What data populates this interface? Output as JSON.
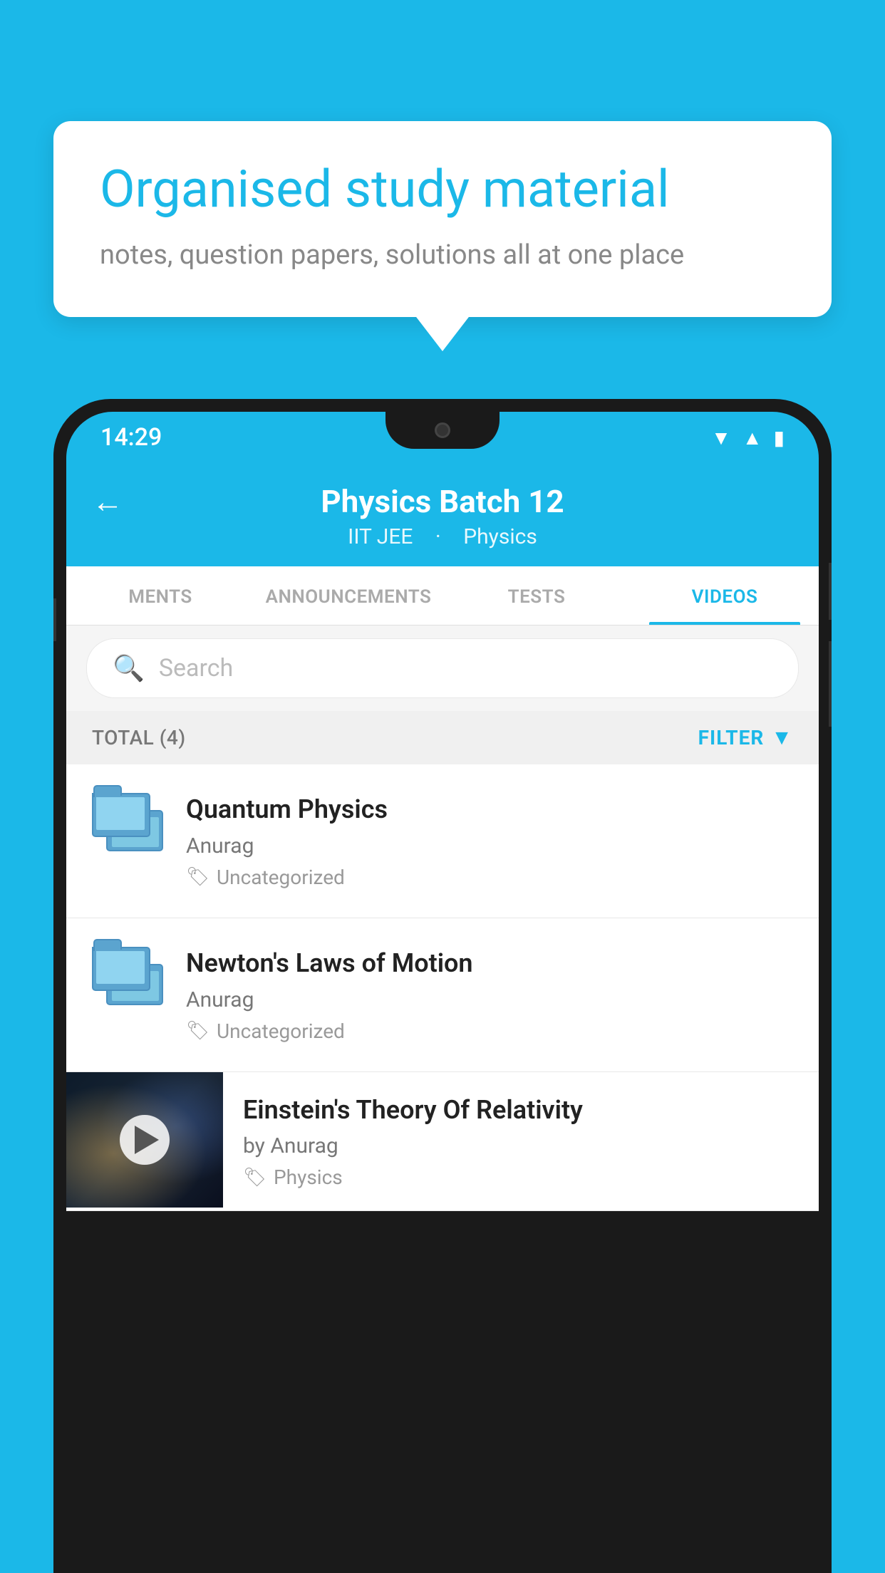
{
  "page": {
    "bg_color": "#1BB8E8"
  },
  "bubble": {
    "title": "Organised study material",
    "subtitle": "notes, question papers, solutions all at one place"
  },
  "status_bar": {
    "time": "14:29"
  },
  "app_header": {
    "title": "Physics Batch 12",
    "subtitle_part1": "IIT JEE",
    "subtitle_part2": "Physics"
  },
  "tabs": [
    {
      "label": "MENTS",
      "active": false
    },
    {
      "label": "ANNOUNCEMENTS",
      "active": false
    },
    {
      "label": "TESTS",
      "active": false
    },
    {
      "label": "VIDEOS",
      "active": true
    }
  ],
  "search": {
    "placeholder": "Search"
  },
  "filter": {
    "total_label": "TOTAL (4)",
    "filter_label": "FILTER"
  },
  "videos": [
    {
      "title": "Quantum Physics",
      "author": "Anurag",
      "tag": "Uncategorized",
      "has_thumb": false
    },
    {
      "title": "Newton's Laws of Motion",
      "author": "Anurag",
      "tag": "Uncategorized",
      "has_thumb": false
    },
    {
      "title": "Einstein's Theory Of Relativity",
      "author": "by Anurag",
      "tag": "Physics",
      "has_thumb": true
    }
  ]
}
